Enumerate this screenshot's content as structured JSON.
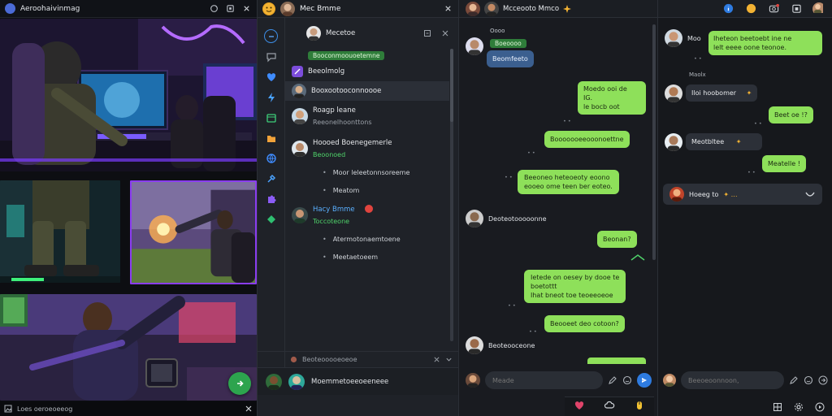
{
  "viewer": {
    "title": "Aeroohaivinmag",
    "caption": "Loes oeroeoeeog"
  },
  "list": {
    "header_name": "Mec Bmme",
    "rows": [
      {
        "name": "Mecetoe"
      },
      {
        "name": "Booconmoouoetemne"
      },
      {
        "name": "Beeolmolg"
      },
      {
        "name": "Booxootooconnoooe"
      },
      {
        "name": "Roagp leane",
        "sub": "Reeonelhoonttons"
      },
      {
        "name": "Hoooed Boenegemerle",
        "sub": "Beoonoed"
      },
      {
        "name": "Hacy Bmme",
        "sub": "Toccoteone"
      }
    ],
    "bullets_a": [
      "Moor leleetonnsoreeme",
      "Meatom"
    ],
    "bullets_b": [
      "Atermotonaemtoene",
      "Meetaetoeem"
    ],
    "status": "Beoteooooeoeoe",
    "footer_label": "Moemmetoeeoeeneee"
  },
  "chat": {
    "header_title": "Mcceooto Mmco",
    "badge_label": "Oooo",
    "tag_label": "Boeoooo",
    "blue_msg": "Beomfeeto",
    "sender_1": "Deoteotooooonne",
    "sender_2": "Beoteooceone",
    "messages": [
      {
        "text": "Moedo ooi de"
      },
      {
        "text": "IG."
      },
      {
        "text": "le  bocb oot"
      },
      {
        "text": "Booooooeeooonoettne"
      },
      {
        "text": "Beeoneo heteoeoty eoono"
      },
      {
        "text": "eooeo ome teen ber eoteo."
      },
      {
        "text": "Beonan?"
      },
      {
        "text": "Ietede on oesey by dooe te"
      },
      {
        "text": "boetottt"
      },
      {
        "text": "Ihat bneot toe teoeeoeoe"
      },
      {
        "text": "Beooeet deo cotoon?"
      }
    ],
    "input_placeholder": "Meade"
  },
  "side": {
    "messages": [
      {
        "name": "Moo",
        "text": "Iheteon beetoebt ine ne"
      },
      {
        "text": "lelt eeee oone teonoe."
      },
      {
        "name": "Maolx",
        "text": "Iloi hoobomer"
      },
      {
        "text": "Beet oe !?"
      },
      {
        "text": "Meotbltee"
      },
      {
        "text": "Meatelle !"
      },
      {
        "text": "Hoeeg to"
      }
    ],
    "input_placeholder": "Beeoeoonnoon,"
  },
  "colors": {
    "accent_green": "#8ee05a",
    "accent_blue": "#3b5f8f",
    "fab_green": "#2da44e",
    "bg_dark": "#17191d"
  }
}
